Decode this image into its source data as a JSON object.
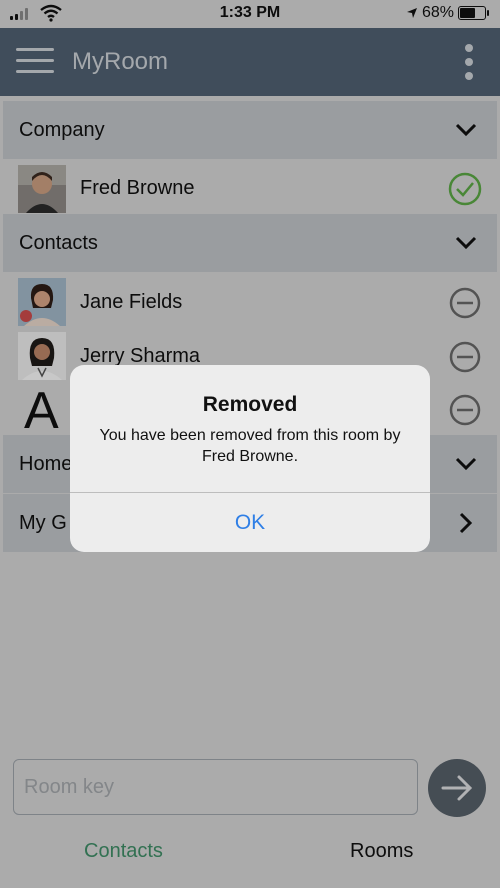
{
  "status_bar": {
    "time": "1:33 PM",
    "battery": "68%",
    "battery_level": 0.68
  },
  "app_bar": {
    "title": "MyRoom",
    "menu_icon": "hamburger-menu-icon",
    "overflow_icon": "more-vertical-icon"
  },
  "sections": {
    "company": {
      "label": "Company",
      "icon": "chevron-down-icon"
    },
    "contacts": {
      "label": "Contacts",
      "icon": "chevron-down-icon"
    },
    "home": {
      "label": "Home",
      "icon": "chevron-down-icon"
    },
    "my_g": {
      "label": "My G",
      "icon": "chevron-right-icon"
    }
  },
  "company_rows": [
    {
      "name": "Fred Browne",
      "status_icon": "check-circle-icon"
    }
  ],
  "contact_rows": [
    {
      "name": "Jane Fields",
      "status_icon": "minus-circle-icon"
    },
    {
      "name": "Jerry Sharma",
      "status_icon": "minus-circle-icon"
    },
    {
      "name": "",
      "avatar_letter": "A",
      "status_icon": "minus-circle-icon"
    }
  ],
  "room_key": {
    "placeholder": "Room key",
    "value": ""
  },
  "tabs": {
    "contacts": "Contacts",
    "rooms": "Rooms"
  },
  "alert": {
    "title": "Removed",
    "message": "You have been removed from this room by Fred Browne.",
    "button": "OK"
  },
  "colors": {
    "app_bar": "#4f5f6f",
    "section": "#bcc0c4",
    "accent_green": "#3d8a64",
    "check_green": "#5aa544",
    "link_blue": "#2f7fe6"
  }
}
